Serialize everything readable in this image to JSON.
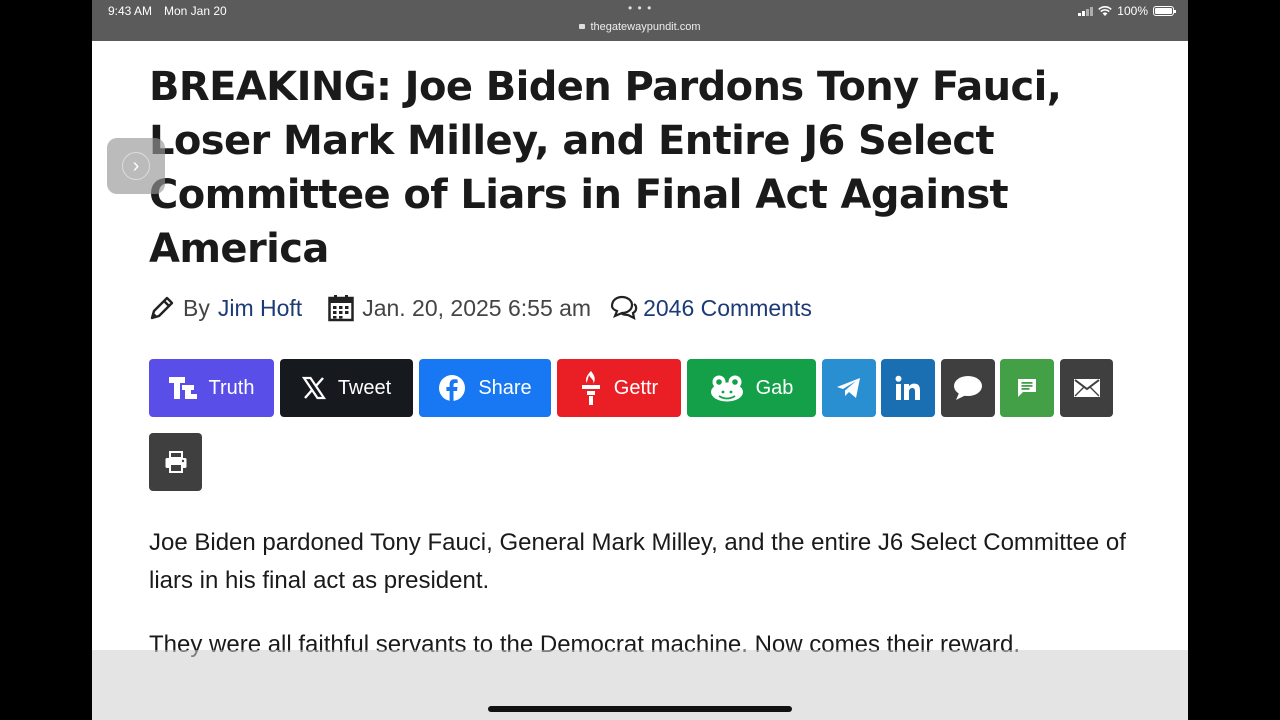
{
  "status_bar": {
    "time": "9:43 AM",
    "date": "Mon Jan 20",
    "url": "thegatewaypundit.com",
    "battery": "100%"
  },
  "article": {
    "headline": "BREAKING: Joe Biden Pardons Tony Fauci, Loser Mark Milley, and Entire J6 Select Committee of Liars in Final Act Against America",
    "by_label": "By",
    "author": "Jim Hoft",
    "date": "Jan. 20, 2025 6:55 am",
    "comments": "2046 Comments",
    "paragraphs": [
      "Joe Biden pardoned Tony Fauci, General Mark Milley, and the entire J6 Select Committee of liars in his final act as president.",
      "They were all faithful servants to the Democrat machine. Now comes their reward."
    ]
  },
  "share_buttons": [
    {
      "label": "Truth",
      "icon": "truth-social-icon",
      "color": "#5a4ee8"
    },
    {
      "label": "Tweet",
      "icon": "x-icon",
      "color": "#16191d"
    },
    {
      "label": "Share",
      "icon": "facebook-icon",
      "color": "#1877f2"
    },
    {
      "label": "Gettr",
      "icon": "gettr-icon",
      "color": "#ea1f26"
    },
    {
      "label": "Gab",
      "icon": "gab-icon",
      "color": "#14a049"
    },
    {
      "label": "",
      "icon": "telegram-icon",
      "color": "#2a8fd1"
    },
    {
      "label": "",
      "icon": "linkedin-icon",
      "color": "#1a6fb3"
    },
    {
      "label": "",
      "icon": "comment-icon",
      "color": "#3f3f3f"
    },
    {
      "label": "",
      "icon": "sms-icon",
      "color": "#43a047"
    },
    {
      "label": "",
      "icon": "email-icon",
      "color": "#3f3f3f"
    },
    {
      "label": "",
      "icon": "print-icon",
      "color": "#3f3f3f"
    }
  ]
}
